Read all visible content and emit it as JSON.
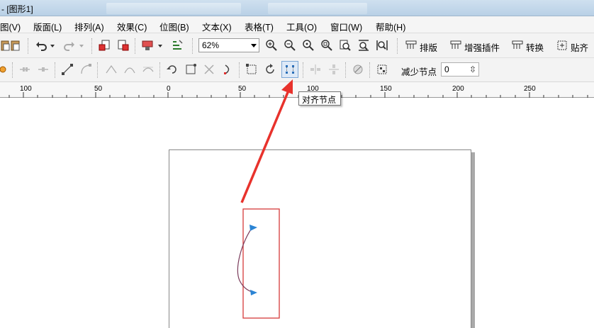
{
  "window": {
    "title": "- [图形1]"
  },
  "menu": {
    "items": [
      "图(V)",
      "版面(L)",
      "排列(A)",
      "效果(C)",
      "位图(B)",
      "文本(X)",
      "表格(T)",
      "工具(O)",
      "窗口(W)",
      "帮助(H)"
    ]
  },
  "toolbar": {
    "zoom": "62%",
    "buttons": [
      "排版",
      "增强插件",
      "转换",
      "贴齐"
    ]
  },
  "property_bar": {
    "reduce_nodes_label": "减少节点",
    "reduce_nodes_value": "0"
  },
  "ruler": {
    "ticks": [
      "100",
      "50",
      "0",
      "50",
      "100",
      "150",
      "200",
      "250"
    ]
  },
  "tooltip": "对齐节点",
  "colors": {
    "arrow": "#e8322c",
    "highlight_box": "#d63a3a",
    "node": "#2b84d4",
    "curve": "#7a3a5a"
  }
}
